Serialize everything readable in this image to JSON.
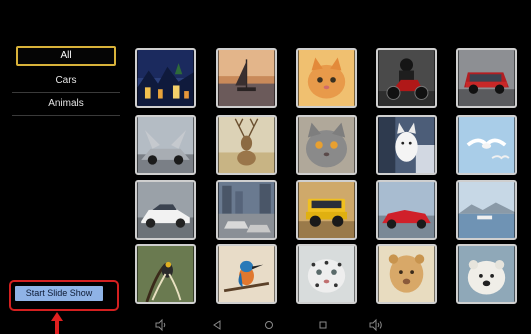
{
  "sidebar": {
    "items": [
      {
        "label": "All",
        "selected": true
      },
      {
        "label": "Cars",
        "selected": false
      },
      {
        "label": "Animals",
        "selected": false
      }
    ],
    "slideshow_label": "Start Slide Show"
  },
  "colors": {
    "selection_border": "#d8b23a",
    "button_bg": "#8fb3e6",
    "annotation_red": "#e02020"
  },
  "gallery": {
    "thumbnails": [
      {
        "icon": "night-town-photo"
      },
      {
        "icon": "sailboat-sunset-photo"
      },
      {
        "icon": "kitten-photo"
      },
      {
        "icon": "motorcycle-rider-photo"
      },
      {
        "icon": "red-suv-photo"
      },
      {
        "icon": "gullwing-car-photo"
      },
      {
        "icon": "deer-photo"
      },
      {
        "icon": "gray-cat-photo"
      },
      {
        "icon": "white-dog-photo"
      },
      {
        "icon": "seagull-photo"
      },
      {
        "icon": "white-sportscar-photo"
      },
      {
        "icon": "cars-cityscape-photo"
      },
      {
        "icon": "yellow-truck-photo"
      },
      {
        "icon": "red-convertible-photo"
      },
      {
        "icon": "harbor-photo"
      },
      {
        "icon": "bird-of-paradise-photo"
      },
      {
        "icon": "kingfisher-photo"
      },
      {
        "icon": "snow-leopard-photo"
      },
      {
        "icon": "lion-cub-photo"
      },
      {
        "icon": "polar-bear-photo"
      }
    ]
  },
  "navbar": {
    "icons": [
      "volume-down-icon",
      "back-icon",
      "home-icon",
      "recents-icon",
      "volume-up-icon"
    ]
  }
}
